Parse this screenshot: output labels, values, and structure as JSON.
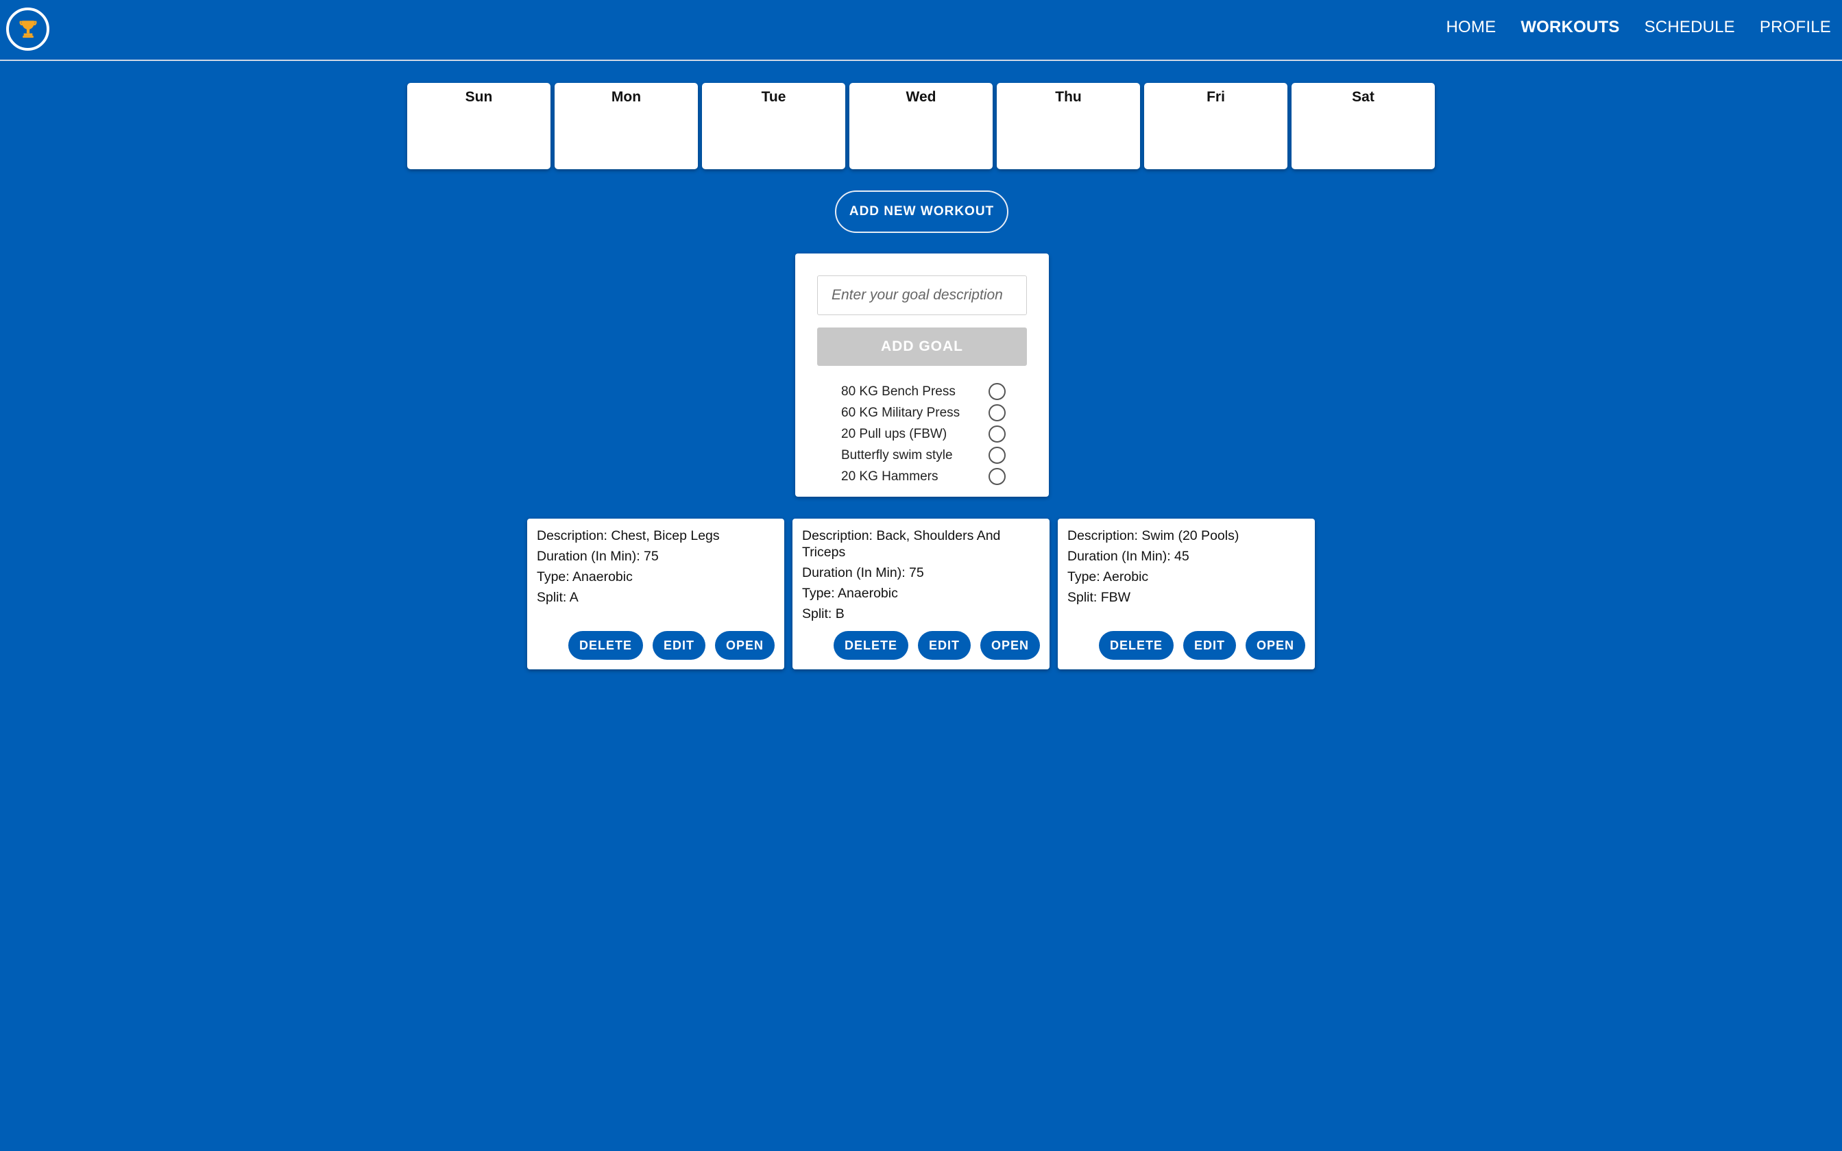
{
  "header": {
    "logo_icon": "trophy-icon",
    "nav": [
      {
        "label": "HOME",
        "active": false
      },
      {
        "label": "WORKOUTS",
        "active": true
      },
      {
        "label": "SCHEDULE",
        "active": false
      },
      {
        "label": "PROFILE",
        "active": false
      }
    ]
  },
  "days": [
    "Sun",
    "Mon",
    "Tue",
    "Wed",
    "Thu",
    "Fri",
    "Sat"
  ],
  "add_workout_label": "ADD NEW WORKOUT",
  "goals": {
    "input_placeholder": "Enter your goal description",
    "input_value": "",
    "add_label": "ADD GOAL",
    "items": [
      {
        "label": "80 KG Bench Press",
        "done": false
      },
      {
        "label": "60 KG Military Press",
        "done": false
      },
      {
        "label": "20 Pull ups (FBW)",
        "done": false
      },
      {
        "label": "Butterfly swim style",
        "done": false
      },
      {
        "label": "20 KG Hammers",
        "done": false
      }
    ]
  },
  "workouts": [
    {
      "description": "Description: Chest, Bicep Legs",
      "duration": "Duration (In Min): 75",
      "type": "Type: Anaerobic",
      "split": "Split: A"
    },
    {
      "description": "Description: Back, Shoulders And Triceps",
      "duration": "Duration (In Min): 75",
      "type": "Type: Anaerobic",
      "split": "Split: B"
    },
    {
      "description": "Description: Swim (20 Pools)",
      "duration": "Duration (In Min): 45",
      "type": "Type: Aerobic",
      "split": "Split: FBW"
    }
  ],
  "card_actions": {
    "delete": "DELETE",
    "edit": "EDIT",
    "open": "OPEN"
  },
  "colors": {
    "background": "#005eb6",
    "trophy": "#f5a623",
    "button_disabled": "#c8c8c8"
  }
}
